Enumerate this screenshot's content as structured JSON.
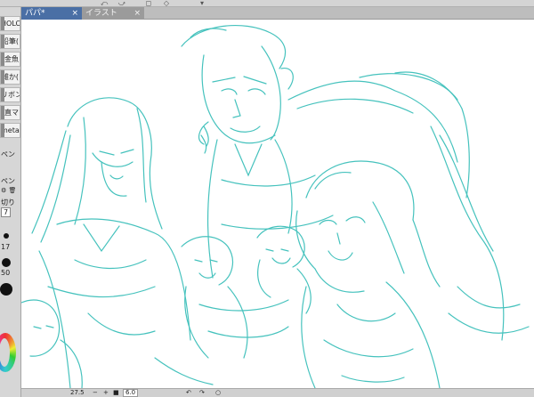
{
  "app": {
    "tabs": [
      {
        "label": "パパ*",
        "close": "×"
      },
      {
        "label": "イラスト",
        "close": "×"
      }
    ],
    "subtools": [
      {
        "label": "HOLO"
      },
      {
        "label": "鉛筆("
      },
      {
        "label": "金魚"
      },
      {
        "label": "雑か("
      },
      {
        "label": "リボン"
      },
      {
        "label": "直マ"
      },
      {
        "label": "metal"
      }
    ],
    "panel_texts": {
      "pen_label_1": "ペン",
      "pen_label_2": "ペン",
      "ite_label": "切り",
      "size_value_1": "7",
      "size_value_2": "17",
      "size_value_3": "50"
    },
    "status": {
      "left_value": "27.5",
      "zoom_value": "6.0",
      "minus": "−",
      "plus": "+",
      "stop": "■"
    },
    "colors": {
      "line_art": "#3cbfba",
      "active_tab": "#4a6fa5"
    }
  }
}
